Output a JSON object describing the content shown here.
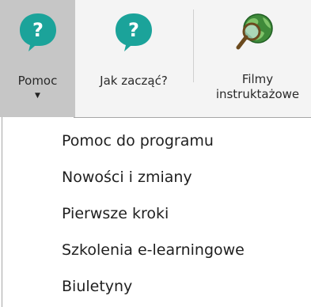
{
  "ribbon": {
    "buttons": [
      {
        "label": "Pomoc",
        "icon": "question-bubble-icon",
        "active": true,
        "has_dropdown": true
      },
      {
        "label": "Jak zacząć?",
        "icon": "question-bubble-icon",
        "active": false
      },
      {
        "label": "Filmy instruktażowe",
        "icon": "globe-magnifier-icon",
        "active": false
      }
    ],
    "dropdown_arrow": "▼"
  },
  "menu": {
    "items": [
      {
        "label": "Pomoc do programu"
      },
      {
        "label": "Nowości i zmiany"
      },
      {
        "label": "Pierwsze kroki"
      },
      {
        "label": "Szkolenia e-learningowe"
      },
      {
        "label": "Biuletyny"
      }
    ]
  },
  "colors": {
    "icon_teal": "#1ba39a",
    "active_bg": "#c6c6c6",
    "ribbon_bg": "#f4f4f4"
  }
}
